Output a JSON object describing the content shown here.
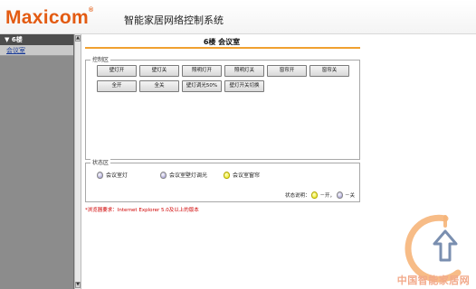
{
  "header": {
    "logo": "Maxicom",
    "logo_mark": "®",
    "title": "智能家居网络控制系统"
  },
  "sidebar": {
    "group_label": "▼ 6楼",
    "items": [
      {
        "label": "会议室"
      }
    ]
  },
  "scrollbar": {
    "up_glyph": "▲",
    "down_glyph": "▼"
  },
  "main": {
    "title": "6楼  会议室",
    "control": {
      "legend": "控制区",
      "buttons_row1": [
        "壁灯开",
        "壁灯关",
        "照明灯开",
        "照明灯关",
        "窗帘开",
        "窗帘关"
      ],
      "buttons_row2": [
        "全开",
        "全关",
        "壁灯调光50%",
        "壁灯开关切换"
      ]
    },
    "status": {
      "legend": "状态区",
      "devices": [
        {
          "label": "会议室灯",
          "state": "off"
        },
        {
          "label": "会议室壁灯调光",
          "state": "off"
        },
        {
          "label": "会议室窗帘",
          "state": "on"
        }
      ],
      "legend_text": "状态说明：",
      "on_text": "－开，",
      "off_text": "－关"
    },
    "note": "*浏览器要求：Internet Explorer 5.0及以上的版本"
  },
  "watermark": {
    "text": "中国智能家居网"
  },
  "colors": {
    "accent": "#f0a030",
    "logo": "#e35b12",
    "note": "#d00000",
    "sidebar_bg": "#8c8c8c"
  }
}
